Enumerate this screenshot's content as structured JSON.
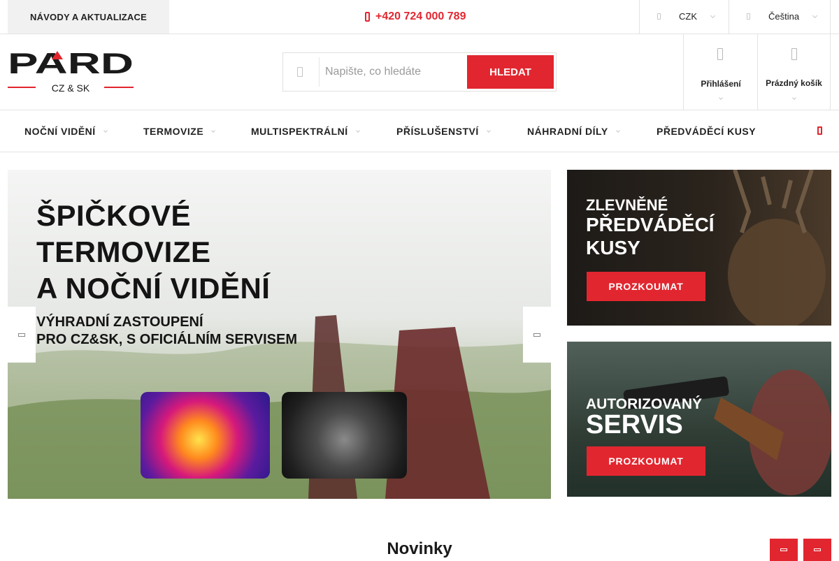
{
  "topbar": {
    "guides_label": "NÁVODY A AKTUALIZACE",
    "phone": "+420 724 000 789",
    "currency": "CZK",
    "language": "Čeština"
  },
  "header": {
    "logo": {
      "brand": "PARD",
      "region": "CZ & SK"
    },
    "search": {
      "placeholder": "Napište, co hledáte",
      "value": "",
      "button_label": "HLEDAT"
    },
    "login_label": "Přihlášení",
    "cart_label": "Prázdný košík"
  },
  "nav": {
    "items": [
      {
        "label": "NOČNÍ VIDĚNÍ",
        "has_submenu": true
      },
      {
        "label": "TERMOVIZE",
        "has_submenu": true
      },
      {
        "label": "MULTISPEKTRÁLNÍ",
        "has_submenu": true
      },
      {
        "label": "PŘÍSLUŠENSTVÍ",
        "has_submenu": true
      },
      {
        "label": "NÁHRADNÍ DÍLY",
        "has_submenu": true
      },
      {
        "label": "PŘEDVÁDĚCÍ KUSY",
        "has_submenu": false
      }
    ]
  },
  "hero": {
    "headline": [
      "ŠPIČKOVÉ",
      "TERMOVIZE",
      "A NOČNÍ VIDĚNÍ"
    ],
    "subline": [
      "VÝHRADNÍ ZASTOUPENÍ",
      "PRO CZ&SK, S OFICIÁLNÍM SERVISEM"
    ]
  },
  "banners": [
    {
      "title": [
        "ZLEVNĚNÉ",
        "PŘEDVÁDĚCÍ",
        "KUSY"
      ],
      "cta": "PROZKOUMAT"
    },
    {
      "title": [
        "AUTORIZOVANÝ",
        "SERVIS"
      ],
      "cta": "PROZKOUMAT"
    }
  ],
  "section": {
    "title": "Novinky"
  },
  "colors": {
    "accent": "#e2262f",
    "text": "#1a1a1a",
    "border": "#e3e3e3"
  },
  "icons": {
    "phone": "phone-icon",
    "currency": "currency-icon",
    "language": "globe-icon",
    "search": "search-icon",
    "login": "user-icon",
    "cart": "cart-icon"
  }
}
